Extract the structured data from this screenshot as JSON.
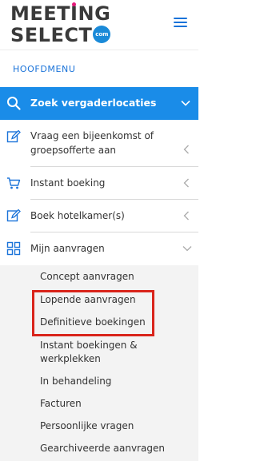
{
  "logo": {
    "line1_pre": "MEET",
    "line1_i": "I",
    "line1_post": "NG",
    "line2": "SELECT",
    "com": "com"
  },
  "menu": {
    "section_label": "HOOFDMENU",
    "active": {
      "label": "Zoek vergaderlocaties",
      "icon": "search-icon"
    },
    "items": [
      {
        "label_line1": "Vraag een bijeenkomst of",
        "label_line2": "groepsofferte aan",
        "icon": "edit-icon"
      },
      {
        "label": "Instant boeking",
        "icon": "cart-icon"
      },
      {
        "label": "Boek hotelkamer(s)",
        "icon": "edit-icon"
      },
      {
        "label": "Mijn aanvragen",
        "icon": "grid-icon"
      }
    ],
    "submenu": [
      "Concept aanvragen",
      "Lopende aanvragen",
      "Definitieve boekingen",
      "Instant boekingen &",
      "werkplekken",
      "In behandeling",
      "Facturen",
      "Persoonlijke vragen",
      "Gearchiveerde aanvragen"
    ]
  },
  "colors": {
    "accent": "#1a8ce8",
    "link": "#1a73d9",
    "highlight": "#d9241b",
    "logo_dot": "#e5197a"
  }
}
